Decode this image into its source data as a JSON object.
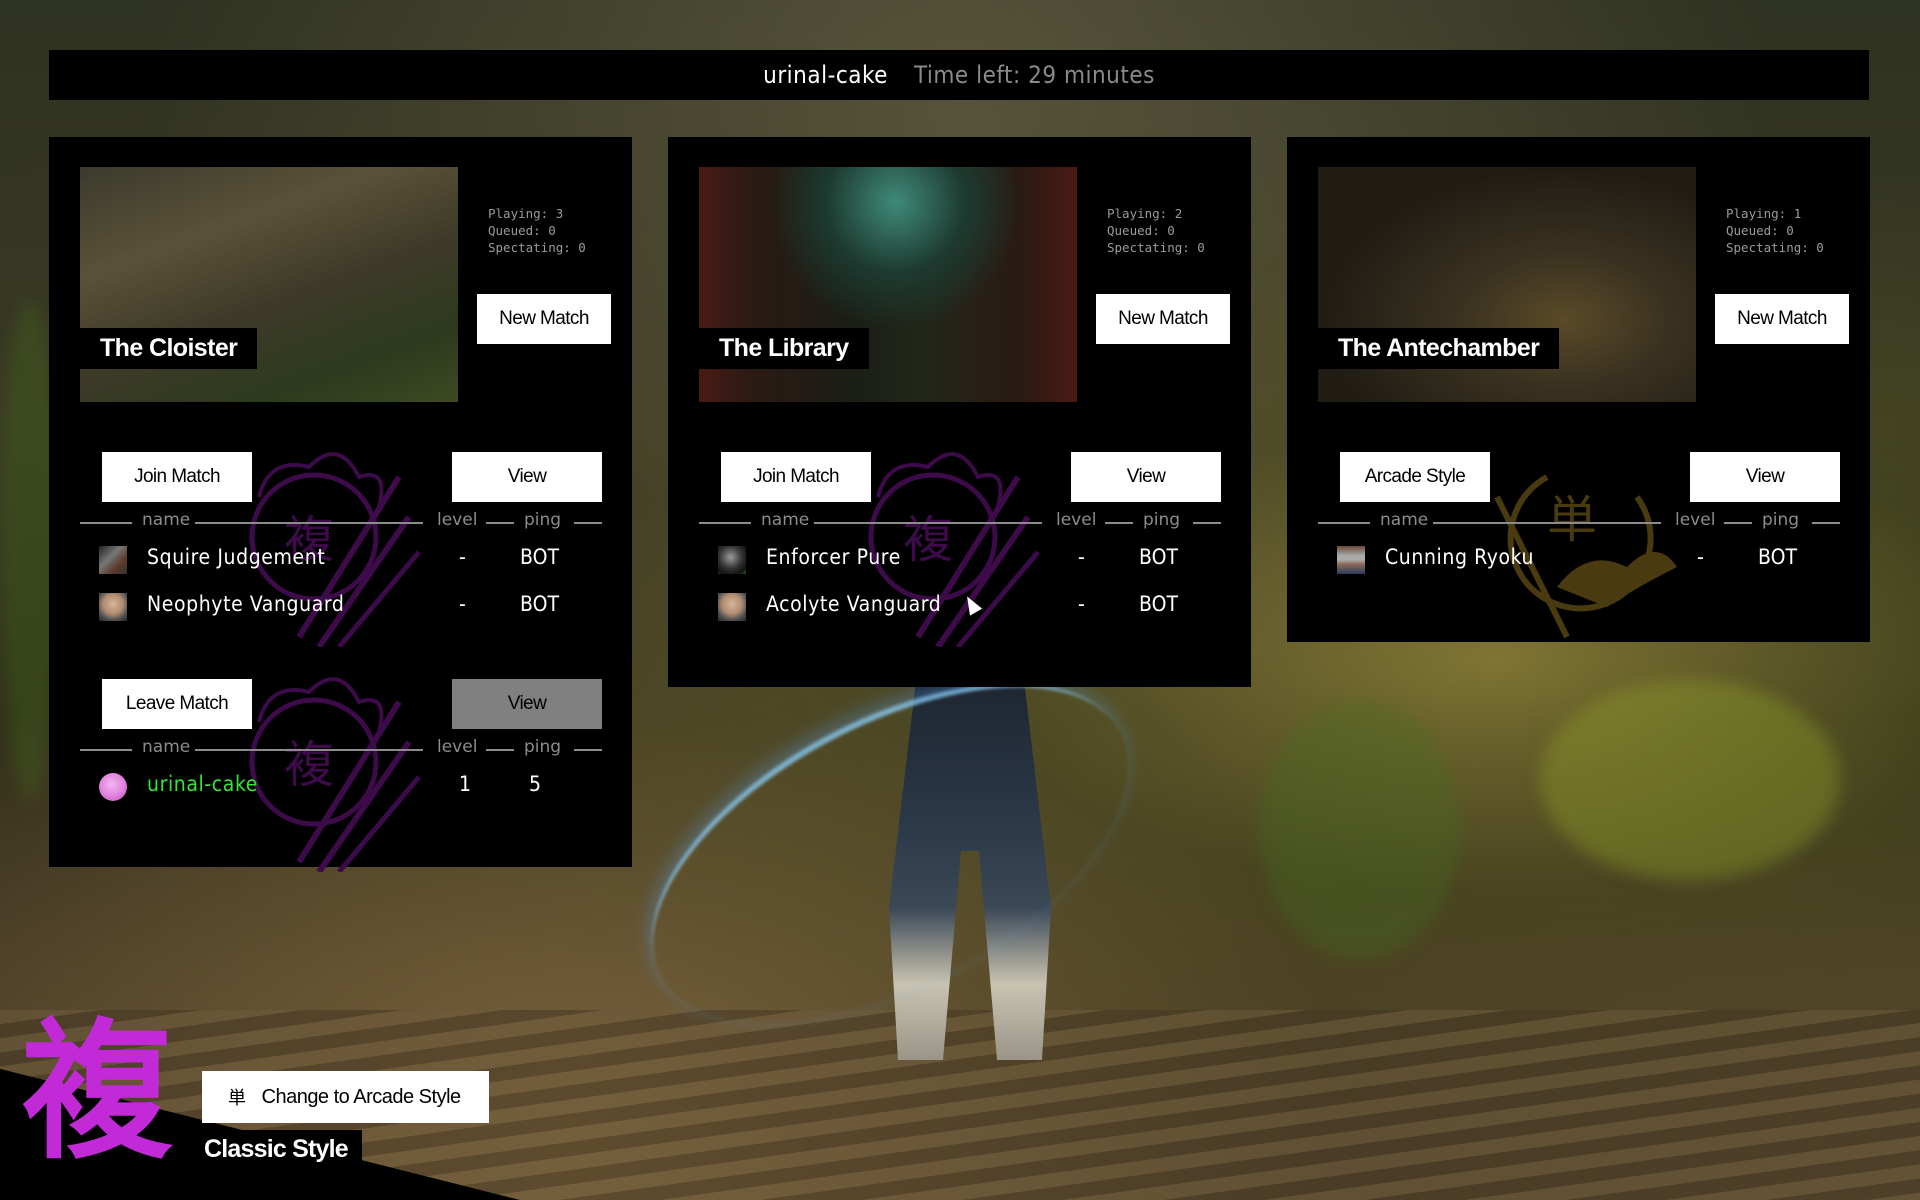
{
  "header": {
    "username": "urinal-cake",
    "time_left": "Time left: 29 minutes"
  },
  "columns": {
    "name": "name",
    "level": "level",
    "ping": "ping"
  },
  "arenas": [
    {
      "title": "The Cloister",
      "stats": {
        "playing": "Playing: 3",
        "queued": "Queued: 0",
        "spectating": "Spectating: 0"
      },
      "new_match_label": "New Match",
      "matches": [
        {
          "action_label": "Join Match",
          "view_label": "View",
          "view_enabled": true,
          "emblem": "classic",
          "players": [
            {
              "name": "Squire Judgement",
              "level": "-",
              "ping": "BOT",
              "avatar": "armored-avatar",
              "self": false
            },
            {
              "name": "Neophyte Vanguard",
              "level": "-",
              "ping": "BOT",
              "avatar": "grey-hair-avatar",
              "self": false
            }
          ]
        },
        {
          "action_label": "Leave Match",
          "view_label": "View",
          "view_enabled": false,
          "emblem": "classic",
          "players": [
            {
              "name": "urinal-cake",
              "level": "1",
              "ping": "5",
              "avatar": "pink-smiley-avatar",
              "self": true
            }
          ]
        }
      ]
    },
    {
      "title": "The Library",
      "stats": {
        "playing": "Playing: 2",
        "queued": "Queued: 0",
        "spectating": "Spectating: 0"
      },
      "new_match_label": "New Match",
      "matches": [
        {
          "action_label": "Join Match",
          "view_label": "View",
          "view_enabled": true,
          "emblem": "classic",
          "players": [
            {
              "name": "Enforcer Pure",
              "level": "-",
              "ping": "BOT",
              "avatar": "masked-avatar",
              "self": false
            },
            {
              "name": "Acolyte Vanguard",
              "level": "-",
              "ping": "BOT",
              "avatar": "grey-hair-avatar",
              "self": false
            }
          ]
        }
      ]
    },
    {
      "title": "The Antechamber",
      "stats": {
        "playing": "Playing: 1",
        "queued": "Queued: 0",
        "spectating": "Spectating: 0"
      },
      "new_match_label": "New Match",
      "matches": [
        {
          "action_label": "Arcade Style",
          "view_label": "View",
          "view_enabled": true,
          "emblem": "arcade",
          "players": [
            {
              "name": "Cunning Ryoku",
              "level": "-",
              "ping": "BOT",
              "avatar": "blindfold-avatar",
              "self": false
            }
          ]
        }
      ]
    }
  ],
  "style_switch": {
    "current_kanji": "複",
    "current_label": "Classic Style",
    "change_icon": "単",
    "change_label": "Change to Arcade Style"
  },
  "colors": {
    "classic_purple": "#c12ad6",
    "emblem_purple": "#3d0a4a",
    "emblem_gold": "#4a3a10",
    "self_green": "#33e633",
    "disabled_button": "#808080",
    "stat_grey": "#9a9a9a"
  }
}
